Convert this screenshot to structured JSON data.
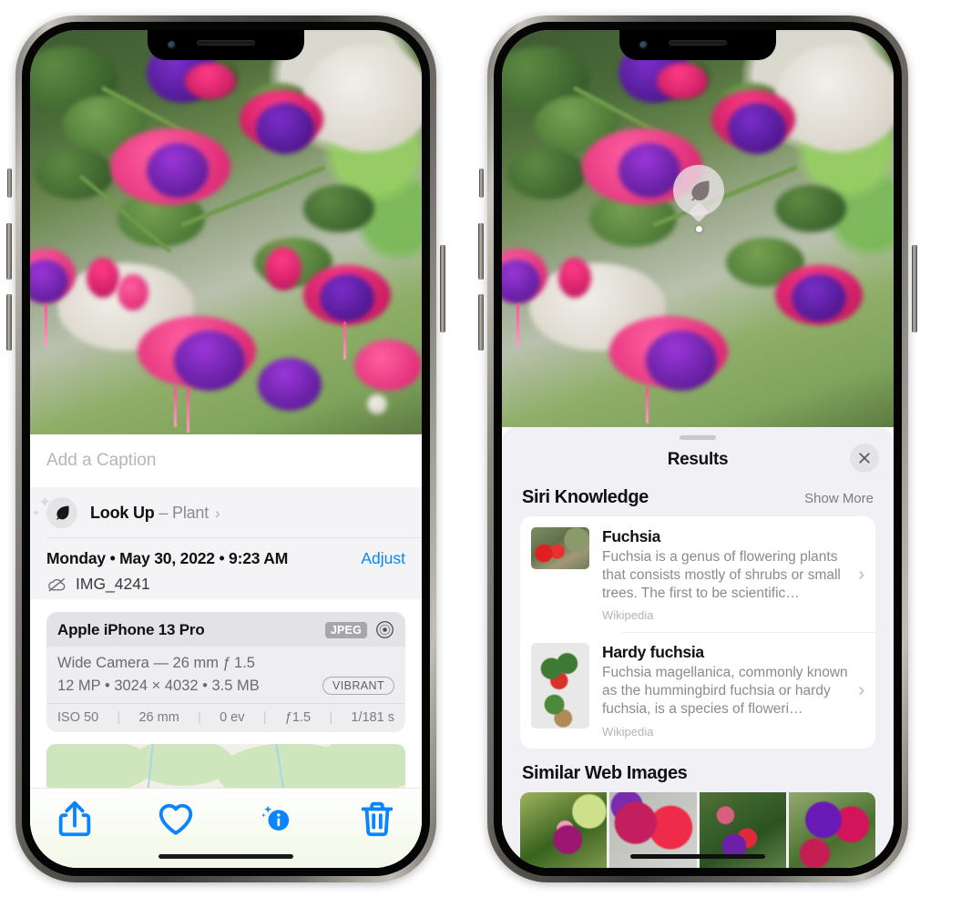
{
  "left_phone": {
    "caption_placeholder": "Add a Caption",
    "lookup": {
      "label": "Look Up",
      "dash": " – ",
      "subject": "Plant",
      "chevron": "›",
      "icon": "leaf-icon"
    },
    "metadata": {
      "date": "Monday • May 30, 2022 • 9:23 AM",
      "adjust_label": "Adjust",
      "filename": "IMG_4241",
      "cloud_icon": "cloud-slash-icon"
    },
    "camera_card": {
      "device": "Apple iPhone 13 Pro",
      "format_badge": "JPEG",
      "aperture_icon": "aperture-icon",
      "lens_line": "Wide Camera — 26 mm ƒ 1.5",
      "size_line": "12 MP • 3024 × 4032 • 3.5 MB",
      "style_badge": "VIBRANT",
      "exif": [
        "ISO 50",
        "26 mm",
        "0 ev",
        "ƒ1.5",
        "1/181 s"
      ],
      "exif_separator": "|"
    },
    "map": {
      "pin": "photo-thumbnail-pin"
    },
    "toolbar": {
      "items": [
        {
          "name": "share-button",
          "icon": "share-icon"
        },
        {
          "name": "favorite-button",
          "icon": "heart-icon"
        },
        {
          "name": "info-button",
          "icon": "info-sparkle-icon"
        },
        {
          "name": "delete-button",
          "icon": "trash-icon"
        }
      ]
    },
    "accent_color": "#0a84ff"
  },
  "right_phone": {
    "visual_lookup_badge": {
      "icon": "leaf-icon"
    },
    "sheet": {
      "title": "Results",
      "close_icon": "close-icon"
    },
    "siri_knowledge": {
      "heading": "Siri Knowledge",
      "action": "Show More",
      "results": [
        {
          "title": "Fuchsia",
          "description": "Fuchsia is a genus of flowering plants that consists mostly of shrubs or small trees. The first to be scientific…",
          "source": "Wikipedia",
          "chevron": "›"
        },
        {
          "title": "Hardy fuchsia",
          "description": "Fuchsia magellanica, commonly known as the hummingbird fuchsia or hardy fuchsia, is a species of floweri…",
          "source": "Wikipedia",
          "chevron": "›"
        }
      ]
    },
    "similar_web_images": {
      "heading": "Similar Web Images",
      "thumbnails": [
        "fuchsia-web-image-1",
        "fuchsia-web-image-2",
        "fuchsia-web-image-3",
        "fuchsia-web-image-4"
      ]
    }
  }
}
